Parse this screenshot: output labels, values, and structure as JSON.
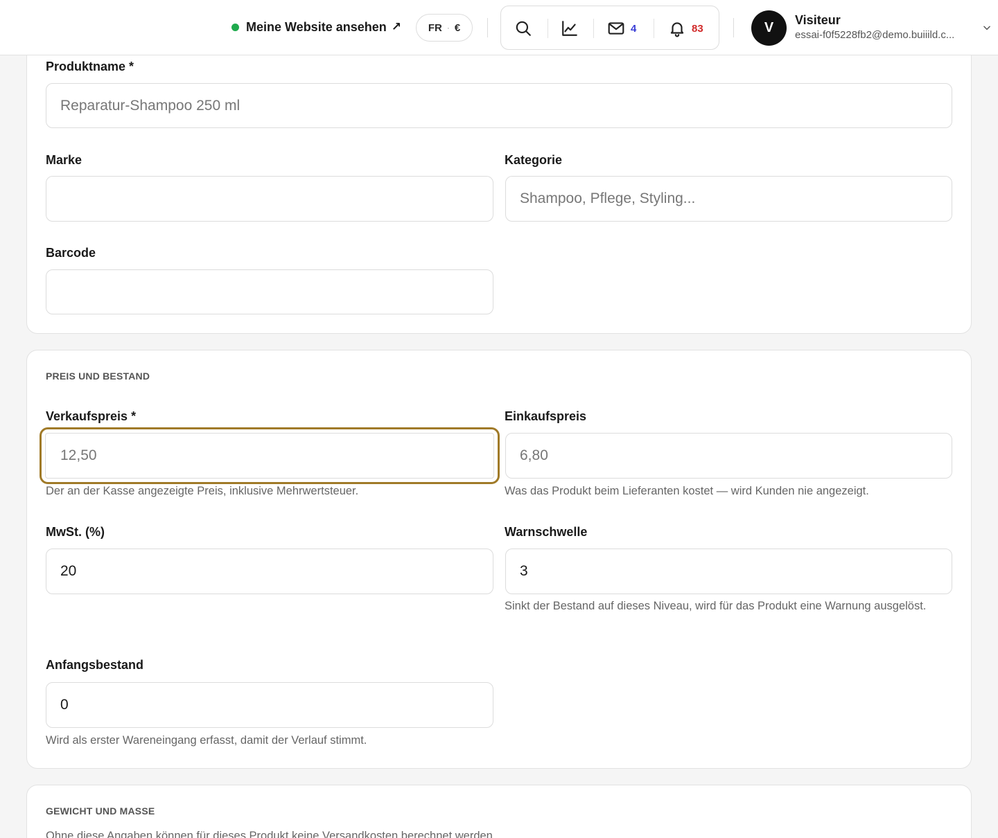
{
  "header": {
    "site_link_label": "Meine Website ansehen",
    "site_link_arrow": "↗",
    "lang": "FR",
    "lang_sep": "·",
    "currency": "€",
    "messages_count": "4",
    "notifications_count": "83",
    "user": {
      "initial": "V",
      "name": "Visiteur",
      "email": "essai-f0f5228fb2@demo.buiiild.c..."
    },
    "icons": [
      "search-icon",
      "chart-line-icon",
      "mail-icon",
      "bell-icon",
      "chevron-down-icon"
    ],
    "status_color": "#1faa4d"
  },
  "product": {
    "name_label": "Produktname *",
    "name_placeholder": "Reparatur-Shampoo 250 ml",
    "brand_label": "Marke",
    "brand_value": "",
    "category_label": "Kategorie",
    "category_placeholder": "Shampoo, Pflege, Styling...",
    "barcode_label": "Barcode",
    "barcode_value": ""
  },
  "price_stock": {
    "title": "PREIS UND BESTAND",
    "sale_price_label": "Verkaufspreis *",
    "sale_price_placeholder": "12,50",
    "sale_price_help": "Der an der Kasse angezeigte Preis, inklusive Mehrwertsteuer.",
    "purchase_price_label": "Einkaufspreis",
    "purchase_price_placeholder": "6,80",
    "purchase_price_help": "Was das Produkt beim Lieferanten kostet — wird Kunden nie angezeigt.",
    "vat_label": "MwSt. (%)",
    "vat_value": "20",
    "threshold_label": "Warnschwelle",
    "threshold_value": "3",
    "threshold_help": "Sinkt der Bestand auf dieses Niveau, wird für das Produkt eine Warnung ausgelöst.",
    "initial_stock_label": "Anfangsbestand",
    "initial_stock_value": "0",
    "initial_stock_help": "Wird als erster Wareneingang erfasst, damit der Verlauf stimmt.",
    "focus_color": "#a07a28"
  },
  "weight": {
    "title": "GEWICHT UND MASSE",
    "cut_text": "Ohne diese Angaben können für dieses Produkt keine Versandkosten berechnet werden."
  }
}
